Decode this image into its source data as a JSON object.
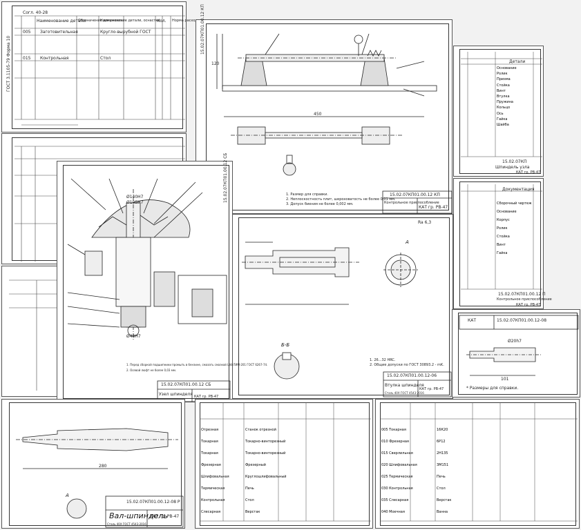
{
  "sheets": {
    "spec_top_left": {
      "header_note": "Согл. 40-28",
      "columns": [
        "Код",
        "Наименование детали",
        "Обозначение документа",
        "Обозначение документа",
        "Наименование детали, оснастки",
        "Кол.",
        "Ед. изм.",
        "Норма расхода"
      ],
      "rows": [
        {
          "left": "005",
          "mid": "Заготовительная",
          "right": "Кругло-вырубной ГОСТ"
        },
        {
          "left": "015",
          "mid": "Контрольная",
          "right": "Стол"
        }
      ],
      "side_label": "ГОСТ 3.1105-79 Форма 10"
    },
    "fixture_main": {
      "title_code": "15.02.07КП01.00.12 КП",
      "title_name": "Контрольное приспособление",
      "group": "КАТ гр. РВ-47",
      "dim_top": "450",
      "dim_left": "120",
      "notes": [
        "1. Размер для справки.",
        "2. Неплоскостность плит, шероховатость не более 0,01 мм.",
        "3. Допуск биения не более 0,002 мм."
      ]
    },
    "spindle_assembly": {
      "title_code": "15.02.07КП01.00.12 СБ",
      "title_name": "Узел шпинделя",
      "group": "КАТ гр. РВ-47",
      "dims": [
        "Ø140H7",
        "Ø105H7",
        "Ø48H7",
        "Ø45"
      ],
      "notes": [
        "1. Перед сборкой подшипники промыть в бензине, смазать смазкой ЦИАТИМ-201 ГОСТ 6267-74.",
        "2. Осевой люфт не более 0,03 мм."
      ],
      "side_label": "15.02.07КП01.00.12 СБ"
    },
    "shaft_drawing": {
      "title_code": "15.02.07КП01.00.12-06",
      "title_name": "Втулка шпинделя",
      "group": "КАТ гр. РВ-47",
      "material": "Сталь 40Х ГОСТ 4543-2016",
      "roughness": "Ra 6,3",
      "section_a": "А",
      "section_b": "Б-Б",
      "notes": [
        "1. 26...32 HRC.",
        "2. Общие допуски по ГОСТ 30893.2 - mK."
      ]
    },
    "spec_right_1": {
      "title_code": "15.02.07КП",
      "title_name": "Шпиндель узла",
      "group": "КАТ гр. РВ-47",
      "section_title": "Детали",
      "items": [
        "Основание",
        "Ролик",
        "Призма",
        "Стойка",
        "Винт",
        "Втулка",
        "Пружина",
        "Кольцо",
        "Ось",
        "Гайка",
        "Шайба"
      ]
    },
    "spec_right_2": {
      "title_code": "15.02.07КП01.00.12 П",
      "title_name": "Контрольное приспособление",
      "group": "КАТ гр. РВ-47",
      "section_title": "Документация",
      "items": [
        "Сборочный чертеж",
        "Основание",
        "Корпус",
        "Ролик",
        "Стойка",
        "Винт",
        "Гайка"
      ]
    },
    "detail_right": {
      "title_code": "КАТ",
      "title_name": "15.02.07КП01.00.12-08",
      "dims": [
        "Ø20h7",
        "Ø2",
        "11",
        "101"
      ],
      "note": "* Размеры для справки."
    },
    "shaft_bottom_left": {
      "title_code": "15.02.07КП01.00.12-08 Р",
      "title_name": "Вал-шпиндель",
      "group": "КАТ гр. РВ-47",
      "material": "Сталь 40Х ГОСТ 4543-2016",
      "dim_total": "280",
      "section": "А"
    },
    "route_mid": {
      "ops": [
        "Отрезная",
        "Токарная",
        "Токарная",
        "Фрезерная",
        "Шлифовальная",
        "Термическая",
        "Контрольная",
        "Слесарная"
      ],
      "note_col": [
        "Станок отрезной",
        "Токарно-винторезный",
        "Токарно-винторезный",
        "Фрезерный",
        "Круглошлифовальный",
        "Печь",
        "Стол",
        "Верстак"
      ]
    },
    "route_right": {
      "ops": [
        "005 Токарная",
        "010 Фрезерная",
        "015 Сверлильная",
        "020 Шлифовальная",
        "025 Термическая",
        "030 Контрольная",
        "035 Слесарная",
        "040 Моечная"
      ],
      "note_col": [
        "16К20",
        "6Р12",
        "2Н135",
        "3М151",
        "Печь",
        "Стол",
        "Верстак",
        "Ванна"
      ]
    }
  }
}
